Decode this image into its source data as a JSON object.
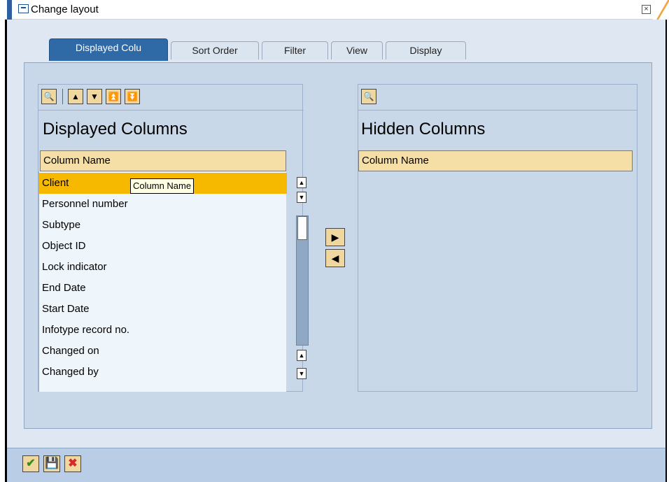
{
  "window": {
    "title": "Change layout",
    "close_icon": "close-icon"
  },
  "tabs": [
    {
      "label": "Displayed Colu",
      "active": true
    },
    {
      "label": "Sort Order",
      "active": false
    },
    {
      "label": "Filter",
      "active": false
    },
    {
      "label": "View",
      "active": false
    },
    {
      "label": "Display",
      "active": false
    }
  ],
  "displayed": {
    "heading": "Displayed Columns",
    "column_header": "Column Name",
    "tooltip": "Column Name",
    "rows": [
      "Client",
      "Personnel number",
      "Subtype",
      "Object ID",
      "Lock indicator",
      "End Date",
      "Start Date",
      "Infotype record no.",
      "Changed on",
      "Changed by"
    ],
    "selected_row": "Client"
  },
  "hidden": {
    "heading": "Hidden Columns",
    "column_header": "Column Name"
  },
  "footer": {
    "buttons": [
      "confirm",
      "save",
      "cancel"
    ]
  },
  "colors": {
    "tab_active": "#2f6aa7",
    "selected_row": "#f7b800",
    "header_bg": "#f6dfa7"
  }
}
